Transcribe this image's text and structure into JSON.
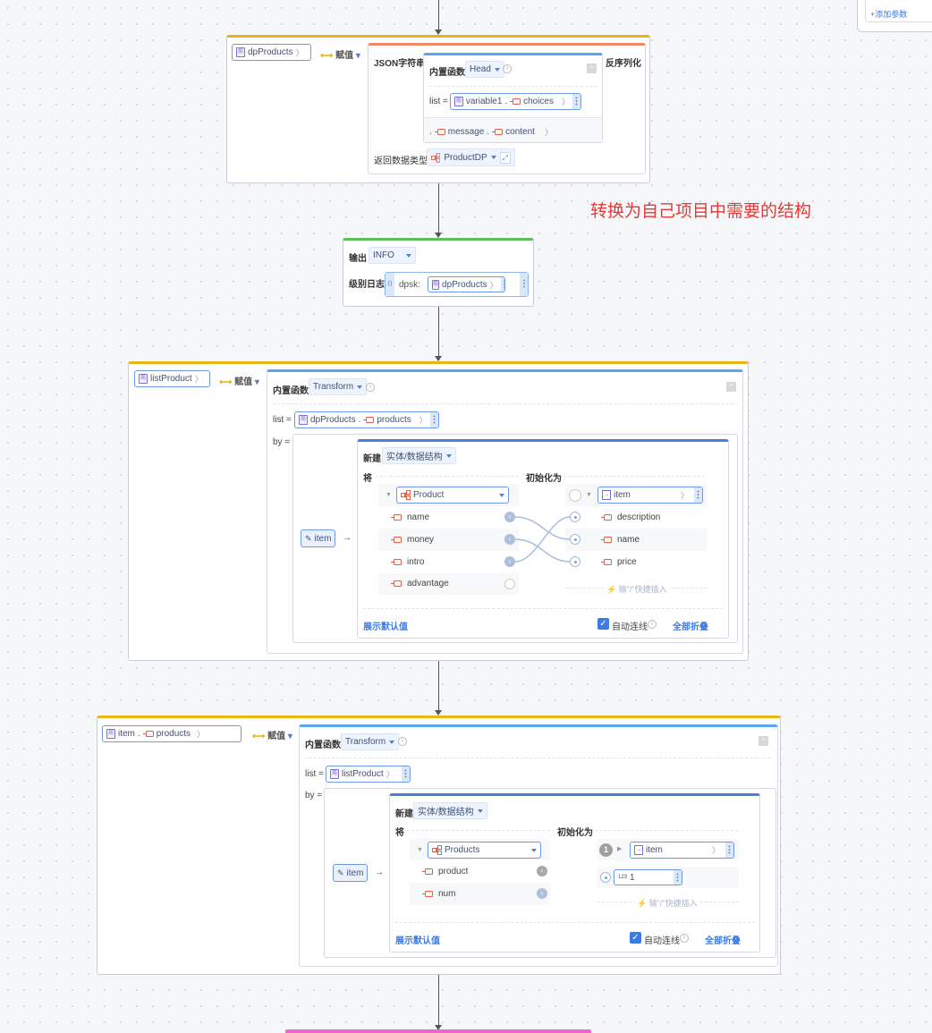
{
  "top_panel": {
    "add_param": "+添加参数"
  },
  "annotation": {
    "text": "转换为自己项目中需要的结构",
    "color": "#e53935"
  },
  "assign_label": "赋值",
  "block1": {
    "target": "dpProducts",
    "json_label": "JSON字符串",
    "deserialize_label": "反序列化",
    "builtin_label": "内置函数",
    "func": "Head",
    "list_label": "list =",
    "list_var": "variable1",
    "list_field": "choices",
    "path": [
      "message",
      "content"
    ],
    "return_type_label": "返回数据类型",
    "return_type": "ProductDP"
  },
  "block2": {
    "output_label": "输出",
    "level": "INFO",
    "log_label": "级别日志",
    "prefix": "dpsk:",
    "var": "dpProducts"
  },
  "block3": {
    "target": "listProduct",
    "builtin_label": "内置函数",
    "func": "Transform",
    "list_label": "list =",
    "list_var": "dpProducts",
    "list_field": "products",
    "by_label": "by =",
    "item": "item",
    "new_label": "新建",
    "new_type": "实体/数据结构",
    "from_label": "将",
    "init_label": "初始化为",
    "source_type": "Product",
    "source_fields": [
      "name",
      "money",
      "intro",
      "advantage"
    ],
    "target_var": "item",
    "target_fields": [
      "description",
      "name",
      "price"
    ],
    "mappings": [
      [
        "name",
        "name"
      ],
      [
        "money",
        "price"
      ],
      [
        "intro",
        "description"
      ]
    ],
    "quick_insert": "输\"/\"快捷插入",
    "show_default": "展示默认值",
    "auto_connect": "自动连线",
    "auto_connect_checked": true,
    "collapse_all": "全部折叠"
  },
  "block4": {
    "target_var": "item",
    "target_field": "products",
    "builtin_label": "内置函数",
    "func": "Transform",
    "list_label": "list =",
    "list_var": "listProduct",
    "by_label": "by =",
    "item": "item",
    "new_label": "新建",
    "new_type": "实体/数据结构",
    "from_label": "将",
    "init_label": "初始化为",
    "source_type": "Products",
    "source_fields": [
      "product",
      "num"
    ],
    "target_badge": "1",
    "num_type_icon": "123",
    "num_value": "1",
    "quick_insert": "输\"/\"快捷插入",
    "show_default": "展示默认值",
    "auto_connect": "自动连线",
    "auto_connect_checked": true,
    "collapse_all": "全部折叠"
  }
}
